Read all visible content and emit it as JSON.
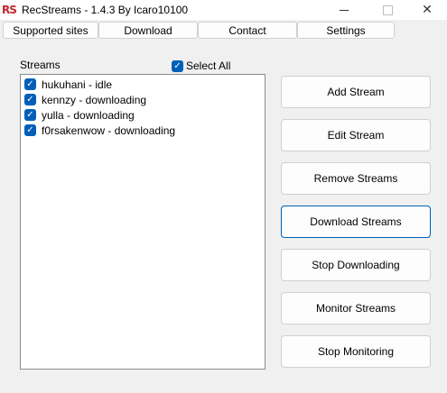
{
  "window": {
    "app_icon_text": "RS",
    "title": "RecStreams - 1.4.3 By Icaro10100",
    "close_glyph": "✕"
  },
  "tabs": [
    {
      "label": "Supported sites"
    },
    {
      "label": "Download"
    },
    {
      "label": "Contact"
    },
    {
      "label": "Settings"
    }
  ],
  "streams_panel": {
    "label": "Streams",
    "select_all": {
      "label": "Select All",
      "checked": true
    },
    "items": [
      {
        "label": "hukuhani - idle",
        "checked": true
      },
      {
        "label": "kennzy - downloading",
        "checked": true
      },
      {
        "label": "yulla - downloading",
        "checked": true
      },
      {
        "label": "f0rsakenwow - downloading",
        "checked": true
      }
    ]
  },
  "actions": [
    {
      "label": "Add Stream"
    },
    {
      "label": "Edit Stream"
    },
    {
      "label": "Remove Streams"
    },
    {
      "label": "Download Streams",
      "focused": true
    },
    {
      "label": "Stop Downloading"
    },
    {
      "label": "Monitor Streams"
    },
    {
      "label": "Stop Monitoring"
    }
  ],
  "colors": {
    "accent": "#005fb8",
    "icon_red": "#c1272d",
    "background": "#f0f0f0"
  },
  "icons": {
    "app": "rs-logo-icon",
    "minimize": "minimize-icon",
    "maximize": "maximize-icon",
    "close": "close-icon",
    "check": "checkmark-icon"
  }
}
